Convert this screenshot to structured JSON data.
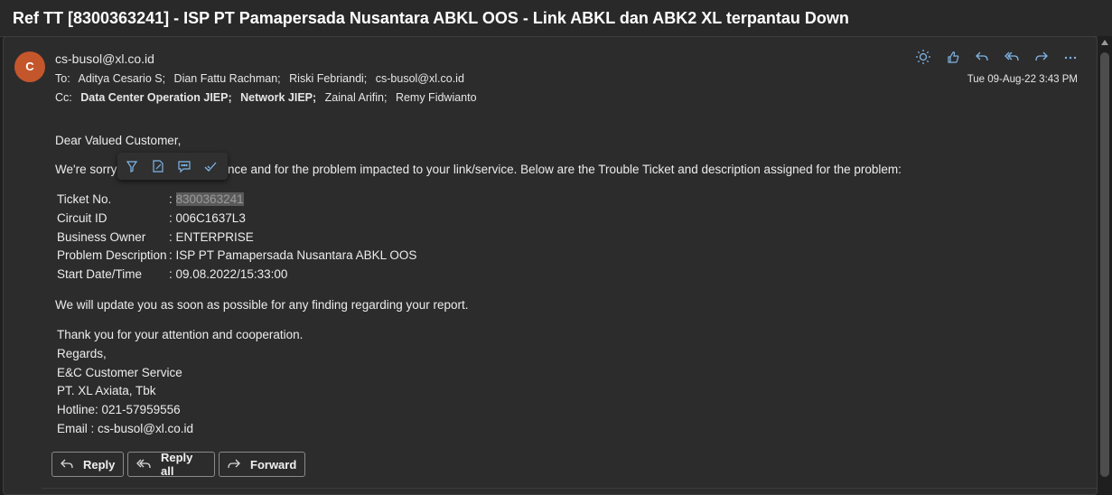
{
  "subject": "Ref TT [8300363241] - ISP PT Pamapersada Nusantara ABKL OOS - Link ABKL dan ABK2 XL terpantau Down",
  "sender": {
    "initial": "C",
    "email": "cs-busol@xl.co.id",
    "avatar_color": "#c4562c"
  },
  "to": {
    "label": "To:",
    "recipients": [
      "Aditya Cesario S;",
      "Dian Fattu Rachman;",
      "Riski Febriandi;",
      "cs-busol@xl.co.id"
    ]
  },
  "cc": {
    "label": "Cc:",
    "recipients": [
      "Data Center Operation JIEP;",
      "Network JIEP;",
      "Zainal Arifin;",
      "Remy Fidwianto"
    ]
  },
  "date": "Tue 09-Aug-22 3:43 PM",
  "header_actions": [
    "sun-icon",
    "like-icon",
    "reply-icon",
    "reply-all-icon",
    "forward-icon",
    "more-icon"
  ],
  "body": {
    "greeting": "Dear Valued Customer,",
    "intro_start": "We're sorry",
    "intro_end": "nce and for the problem impacted to your link/service. Below are the Trouble Ticket and description assigned for the problem:",
    "ticket_table": [
      {
        "label": "Ticket No.",
        "value": ": ",
        "value_highlight": "8300363241"
      },
      {
        "label": "Circuit ID",
        "value": ": 006C1637L3"
      },
      {
        "label": "Business Owner",
        "value": ": ENTERPRISE"
      },
      {
        "label": "Problem Description",
        "value": ": ISP PT Pamapersada Nusantara ABKL OOS"
      },
      {
        "label": "Start Date/Time",
        "value": ": 09.08.2022/15:33:00"
      }
    ],
    "update_line": "We will update you as soon as possible for any finding regarding your report.",
    "closing": [
      "Thank you for your attention and cooperation.",
      "Regards,",
      "E&C Customer Service",
      "PT. XL Axiata, Tbk",
      "Hotline: 021-57959556",
      "Email : cs-busol@xl.co.id"
    ]
  },
  "floating_toolbar": [
    "highlight-icon",
    "edit-note-icon",
    "comment-icon",
    "check-icon"
  ],
  "buttons": {
    "reply": "Reply",
    "reply_all": "Reply all",
    "forward": "Forward"
  },
  "colors": {
    "accent": "#7fb6e8",
    "background": "#1f1f1f",
    "card": "#2c2c2c"
  }
}
